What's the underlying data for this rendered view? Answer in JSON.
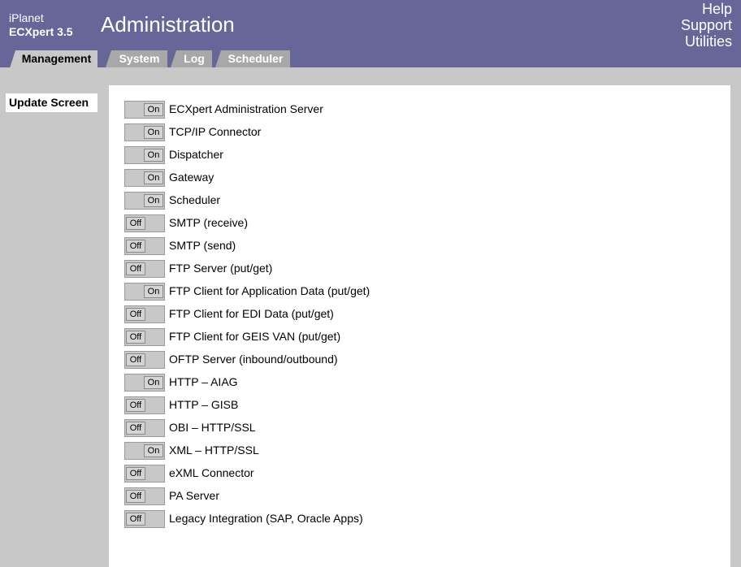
{
  "brand": {
    "line1": "iPlanet",
    "line2": "ECXpert 3.5"
  },
  "page_title": "Administration",
  "top_links": [
    "Help",
    "Support",
    "Utilities"
  ],
  "tabs": [
    {
      "label": "Management",
      "active": true
    },
    {
      "label": "System",
      "active": false
    },
    {
      "label": "Log",
      "active": false
    },
    {
      "label": "Scheduler",
      "active": false
    }
  ],
  "update_button": "Update Screen",
  "services": [
    {
      "name": "ECXpert Administration Server",
      "state": "On"
    },
    {
      "name": "TCP/IP Connector",
      "state": "On"
    },
    {
      "name": "Dispatcher",
      "state": "On"
    },
    {
      "name": "Gateway",
      "state": "On"
    },
    {
      "name": "Scheduler",
      "state": "On"
    },
    {
      "name": "SMTP (receive)",
      "state": "Off"
    },
    {
      "name": "SMTP (send)",
      "state": "Off"
    },
    {
      "name": "FTP Server (put/get)",
      "state": "Off"
    },
    {
      "name": "FTP Client for Application Data (put/get)",
      "state": "On"
    },
    {
      "name": "FTP Client for EDI Data (put/get)",
      "state": "Off"
    },
    {
      "name": "FTP Client for GEIS VAN (put/get)",
      "state": "Off"
    },
    {
      "name": "OFTP Server (inbound/outbound)",
      "state": "Off"
    },
    {
      "name": "HTTP – AIAG",
      "state": "On"
    },
    {
      "name": "HTTP – GISB",
      "state": "Off"
    },
    {
      "name": "OBI – HTTP/SSL",
      "state": "Off"
    },
    {
      "name": "XML – HTTP/SSL",
      "state": "On"
    },
    {
      "name": "eXML Connector",
      "state": "Off"
    },
    {
      "name": "PA Server",
      "state": "Off"
    },
    {
      "name": "Legacy Integration (SAP, Oracle Apps)",
      "state": "Off"
    }
  ],
  "colors": {
    "header": "#666699",
    "background": "#c8c8c8",
    "panel": "#ffffff",
    "tab_inactive": "#a8a8a8"
  }
}
